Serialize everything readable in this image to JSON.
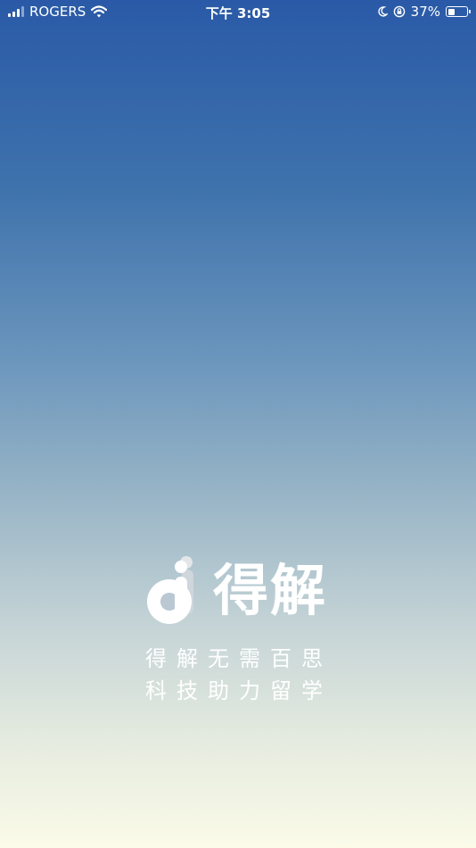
{
  "status_bar": {
    "carrier": "ROGERS",
    "time": "下午 3:05",
    "battery_percent": "37%",
    "battery_level": 0.37,
    "icons": [
      "signal-icon",
      "wifi-icon",
      "moon-icon",
      "orientation-lock-icon",
      "battery-icon"
    ]
  },
  "splash": {
    "app_name": "得解",
    "slogan_line1": "得解无需百思",
    "slogan_line2": "科技助力留学"
  },
  "colors": {
    "gradient_top": "#2a5aa7",
    "gradient_bottom": "#fbfbe8",
    "text": "#ffffff"
  }
}
